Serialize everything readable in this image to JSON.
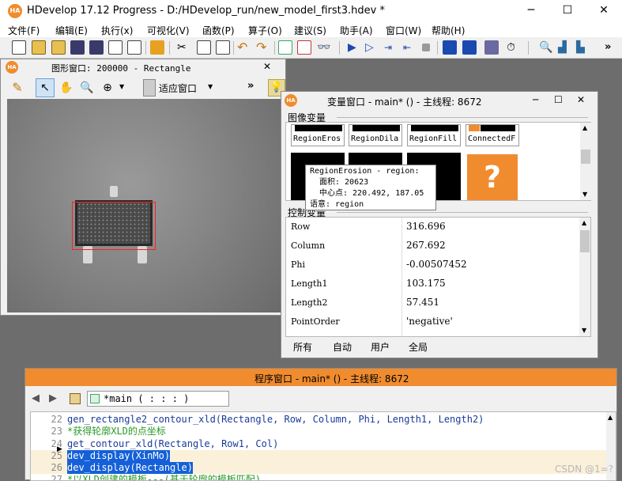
{
  "app": {
    "title": "HDevelop 17.12 Progress - D:/HDevelop_run/new_model_first3.hdev *",
    "logo": "HA",
    "minimize": "─",
    "maximize": "☐",
    "close": "✕"
  },
  "menu": [
    "文件(F)",
    "编辑(E)",
    "执行(x)",
    "可视化(V)",
    "函数(P)",
    "算子(O)",
    "建议(S)",
    "助手(A)",
    "窗口(W)",
    "帮助(H)"
  ],
  "graphics_window": {
    "title": "图形窗口: 200000 - Rectangle",
    "fit_label": "适应窗口",
    "more": "»",
    "close": "✕"
  },
  "variable_window": {
    "title": "变量窗口 - main* () - 主线程: 8672",
    "icon_section": "图像变量",
    "icon_vars": [
      "RegionEros",
      "RegionDila",
      "RegionFill",
      "ConnectedF"
    ],
    "question_mark": "?",
    "tooltip": {
      "line1": "RegionErosion - region:",
      "line2": "面积: 20623",
      "line3": "中心点: 220.492, 187.05",
      "line4": "语意: region"
    },
    "control_section": "控制变量",
    "control_vars": [
      {
        "name": "Row",
        "value": "316.696"
      },
      {
        "name": "Column",
        "value": "267.692"
      },
      {
        "name": "Phi",
        "value": "-0.00507452"
      },
      {
        "name": "Length1",
        "value": "103.175"
      },
      {
        "name": "Length2",
        "value": "57.451"
      },
      {
        "name": "PointOrder",
        "value": "'negative'"
      }
    ],
    "tabs": [
      "所有",
      "自动",
      "用户",
      "全局"
    ],
    "minimize": "─",
    "maximize": "☐",
    "close": "✕"
  },
  "program_window": {
    "title": "程序窗口 - main* () - 主线程: 8672",
    "procedure": "*main ( : : : )",
    "lines": [
      {
        "num": "22",
        "text": "gen_rectangle2_contour_xld(Rectangle, Row, Column, Phi, Length1, Length2)",
        "kind": "code"
      },
      {
        "num": "23",
        "text": "*获得轮廓XLD的点坐标",
        "kind": "comment"
      },
      {
        "num": "24",
        "text": "get_contour_xld(Rectangle, Row1, Col)",
        "kind": "code"
      },
      {
        "num": "25",
        "text": "dev_display(XinMo)",
        "kind": "selected"
      },
      {
        "num": "26",
        "text": "dev_display(Rectangle)",
        "kind": "selected"
      },
      {
        "num": "27",
        "text": "*以XLD创建的模板---(基于轮廓的模板匹配)",
        "kind": "comment"
      }
    ]
  },
  "watermark": "CSDN @1=?"
}
